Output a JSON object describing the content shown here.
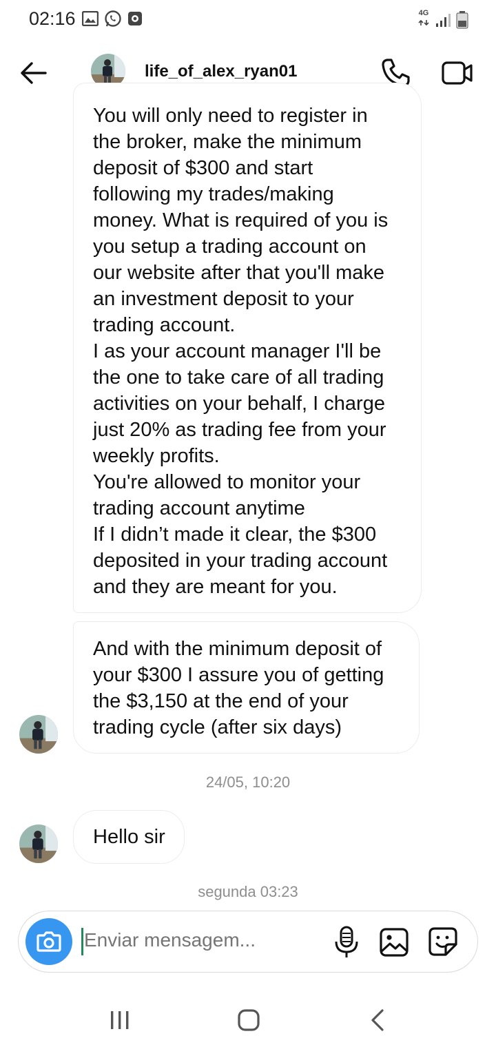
{
  "status_bar": {
    "time": "02:16",
    "network": "4G",
    "icons": [
      "gallery-icon",
      "whatsapp-icon",
      "notification-icon",
      "signal-icon",
      "battery-icon"
    ]
  },
  "header": {
    "username": "life_of_alex_ryan01",
    "icons": [
      "back-arrow-icon",
      "avatar",
      "phone-icon",
      "video-camera-icon"
    ]
  },
  "messages": [
    {
      "sender": "life_of_alex_ryan01",
      "lines": [
        "You will only need to register in",
        "the broker, make the minimum",
        "deposit of $300 and start",
        "following my trades/making",
        "money. What is required of you is",
        "you setup a trading account on",
        "our website after that you'll make",
        "an investment deposit to your",
        "trading account.",
        "I as your account manager I'll be",
        "the one to take care of all trading",
        "activities on your behalf, I charge",
        "just 20% as trading fee from your",
        "weekly profits.",
        "You're allowed to monitor your",
        "trading account anytime",
        "If I didn’t made it clear, the $300",
        "deposited in your trading account",
        "and they are meant for you."
      ]
    },
    {
      "sender": "life_of_alex_ryan01",
      "lines": [
        "And with the minimum deposit of",
        "your $300 I assure you of getting",
        "the $3,150 at the end of your",
        "trading cycle (after six days)"
      ]
    },
    {
      "sender": "life_of_alex_ryan01",
      "lines": [
        "Hello sir"
      ]
    }
  ],
  "timestamps": [
    "24/05, 10:20",
    "segunda 03:23"
  ],
  "composer": {
    "placeholder": "Enviar mensagem...",
    "icons": [
      "camera-icon",
      "microphone-icon",
      "gallery-icon",
      "sticker-icon"
    ]
  },
  "nav": {
    "icons": [
      "recent-apps-icon",
      "home-icon",
      "nav-back-icon"
    ]
  },
  "colors": {
    "accent": "#3797f0",
    "timestamp": "#8e8e8e",
    "bubble_border": "#ececec",
    "placeholder": "#a8a8a8"
  }
}
